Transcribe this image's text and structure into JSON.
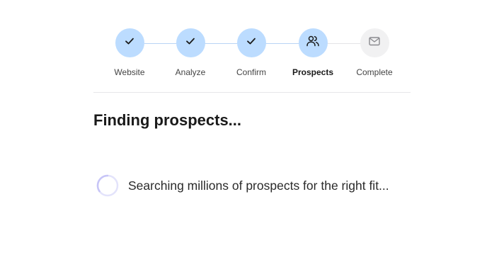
{
  "stepper": {
    "steps": [
      {
        "label": "Website",
        "icon": "check-icon",
        "state": "done"
      },
      {
        "label": "Analyze",
        "icon": "check-icon",
        "state": "done"
      },
      {
        "label": "Confirm",
        "icon": "check-icon",
        "state": "done"
      },
      {
        "label": "Prospects",
        "icon": "users-icon",
        "state": "active"
      },
      {
        "label": "Complete",
        "icon": "mail-icon",
        "state": "pending"
      }
    ]
  },
  "main": {
    "title": "Finding prospects...",
    "status_text": "Searching millions of prospects for the right fit..."
  },
  "colors": {
    "step_done": "#bcdcff",
    "step_pending": "#f1f1f2",
    "connector": "#b9d4f5",
    "spinner_track": "#e3e3fb",
    "spinner_arc": "#c7c5f7"
  }
}
